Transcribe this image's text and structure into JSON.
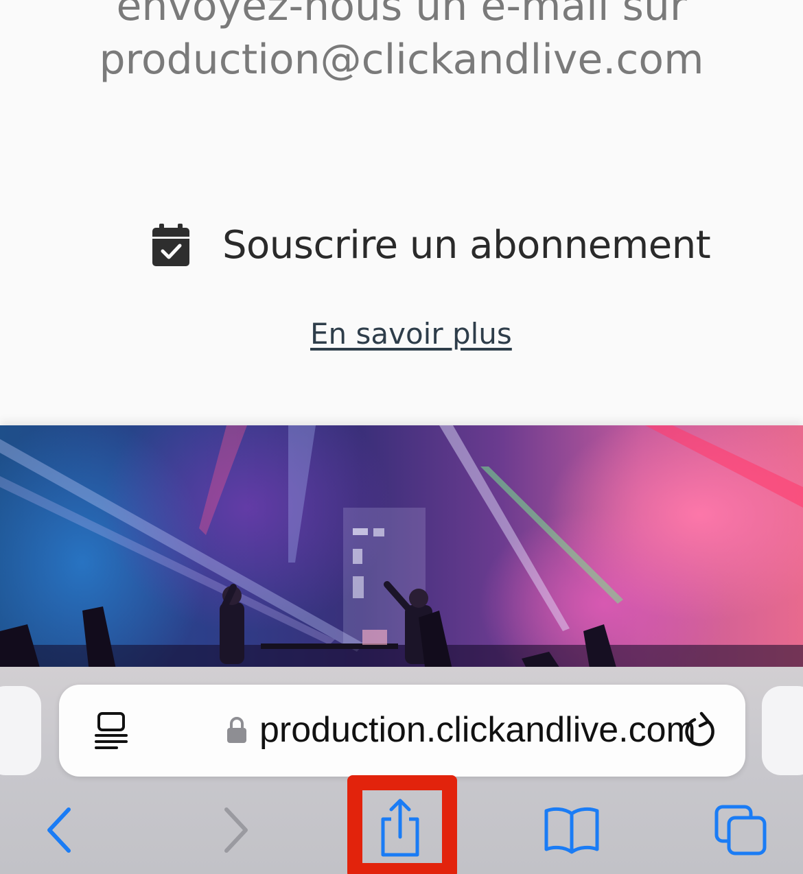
{
  "page": {
    "contact_line_1": "envoyez-nous un e-mail sur",
    "contact_line_2": "production@clickandlive.com"
  },
  "subscription": {
    "icon": "calendar-check-icon",
    "label": "Souscrire un abonnement"
  },
  "learn_more": {
    "label": "En savoir plus"
  },
  "hero_image": {
    "description_icon": "concert-stage-image"
  },
  "browser": {
    "url": "production.clickandlive.com",
    "icons": {
      "reader": "reader-view-icon",
      "lock": "lock-icon",
      "reload": "reload-icon",
      "back": "chevron-left-icon",
      "forward": "chevron-right-icon",
      "share": "share-icon",
      "bookmarks": "book-icon",
      "tabs": "tabs-icon"
    },
    "colors": {
      "accent": "#1a7cf5",
      "disabled": "#9a9aa0",
      "highlight": "#e2230c"
    }
  }
}
